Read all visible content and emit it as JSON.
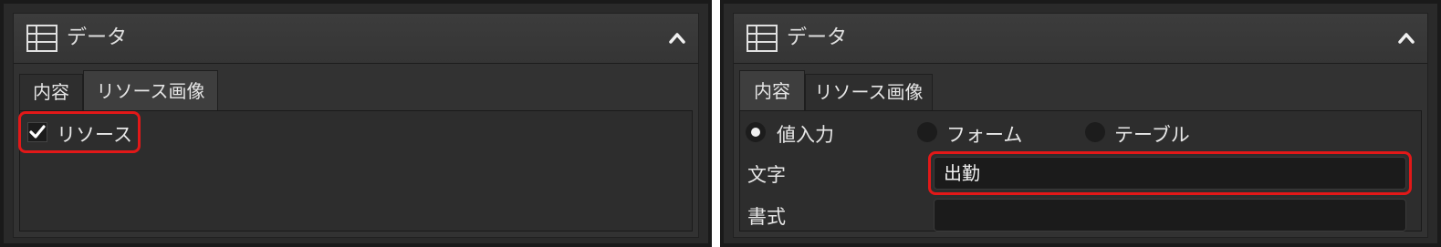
{
  "left_panel": {
    "header": {
      "title": "データ",
      "icon": "table-grid-icon",
      "collapse_icon": "chevron-up-icon"
    },
    "tabs": [
      {
        "label": "内容",
        "active": false
      },
      {
        "label": "リソース画像",
        "active": true
      }
    ],
    "resource_checkbox": {
      "label": "リソース",
      "checked": true
    }
  },
  "right_panel": {
    "header": {
      "title": "データ",
      "icon": "table-grid-icon",
      "collapse_icon": "chevron-up-icon"
    },
    "tabs": [
      {
        "label": "内容",
        "active": true
      },
      {
        "label": "リソース画像",
        "active": false
      }
    ],
    "input_mode": {
      "options": [
        {
          "label": "値入力",
          "selected": true
        },
        {
          "label": "フォーム",
          "selected": false
        },
        {
          "label": "テーブル",
          "selected": false
        }
      ]
    },
    "text_field": {
      "label": "文字",
      "value": "出勤"
    },
    "format_field": {
      "label": "書式",
      "value": ""
    }
  },
  "colors": {
    "highlight": "#e21818",
    "panel_bg": "#2a2a2a"
  }
}
